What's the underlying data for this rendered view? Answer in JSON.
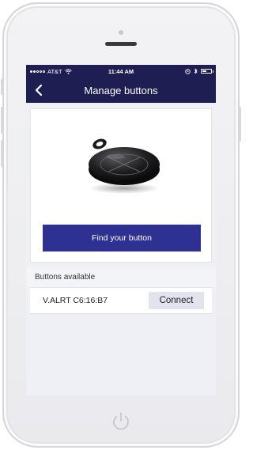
{
  "statusbar": {
    "carrier": "AT&T",
    "time": "11:44 AM"
  },
  "navbar": {
    "title": "Manage buttons",
    "back_icon": "chevron-left-icon"
  },
  "product": {
    "find_button_label": "Find your button"
  },
  "buttons_section": {
    "header": "Buttons available",
    "devices": [
      {
        "name": "V.ALRT C6:16:B7",
        "action_label": "Connect"
      }
    ]
  },
  "colors": {
    "nav_background": "#1f1e53",
    "primary_button": "#2e3092",
    "connect_button": "#e1e3ee"
  },
  "status": {
    "battery_level": 0.5,
    "signal_bars_filled": 2,
    "signal_bars_total": 5
  }
}
